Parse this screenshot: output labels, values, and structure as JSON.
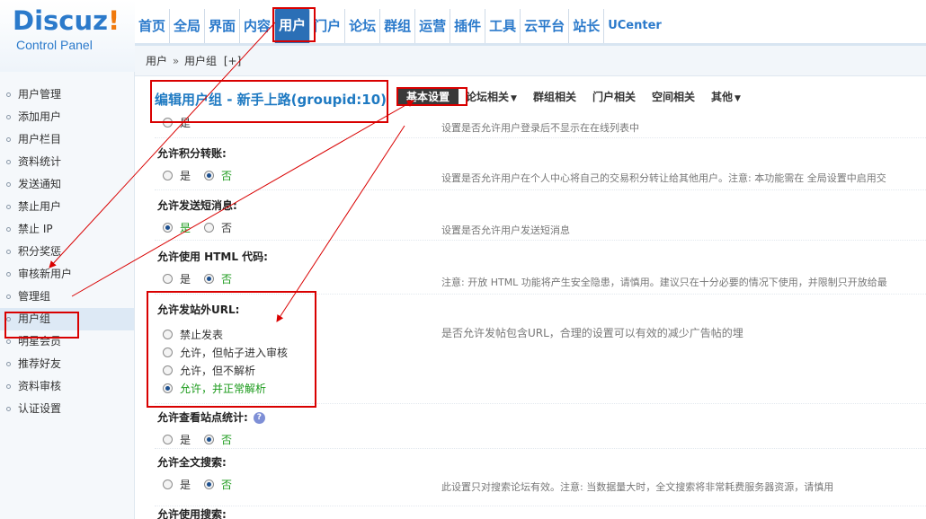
{
  "logo": {
    "brand": "Discuz",
    "bang": "!",
    "subtitle": "Control Panel"
  },
  "topnav": {
    "items": [
      "首页",
      "全局",
      "界面",
      "内容",
      "用户",
      "门户",
      "论坛",
      "群组",
      "运营",
      "插件",
      "工具",
      "云平台",
      "站长",
      "UCenter"
    ],
    "active": "用户"
  },
  "breadcrumb": {
    "first": "用户",
    "separator": "»",
    "second": "用户组",
    "add": "[+]"
  },
  "sidebar": {
    "items": [
      "用户管理",
      "添加用户",
      "用户栏目",
      "资料统计",
      "发送通知",
      "禁止用户",
      "禁止 IP",
      "积分奖惩",
      "审核新用户",
      "管理组",
      "用户组",
      "明星会员",
      "推荐好友",
      "资料审核",
      "认证设置"
    ],
    "active": "用户组"
  },
  "page_title": "编辑用户组 - 新手上路(groupid:10)",
  "tabs": {
    "basic": "基本设置",
    "forum": "论坛相关",
    "group": "群组相关",
    "portal": "门户相关",
    "space": "空间相关",
    "other": "其他"
  },
  "settings": {
    "s0": {
      "yes": "是",
      "hint": "设置是否允许用户登录后不显示在在线列表中"
    },
    "s1": {
      "label": "允许积分转账:",
      "yes": "是",
      "no": "否",
      "hint": "设置是否允许用户在个人中心将自己的交易积分转让给其他用户。注意: 本功能需在 全局设置中启用交"
    },
    "s2": {
      "label": "允许发送短消息:",
      "yes": "是",
      "no": "否",
      "hint": "设置是否允许用户发送短消息"
    },
    "s3": {
      "label": "允许使用 HTML 代码:",
      "yes": "是",
      "no": "否",
      "hint": "注意: 开放 HTML 功能将产生安全隐患，请慎用。建议只在十分必要的情况下使用，并限制只开放给最"
    },
    "s4": {
      "label": "允许发站外URL:",
      "options": [
        "禁止发表",
        "允许，但帖子进入审核",
        "允许，但不解析",
        "允许，并正常解析"
      ],
      "hint": "是否允许发帖包含URL，合理的设置可以有效的减少广告帖的埋"
    },
    "s5": {
      "label": "允许查看站点统计:",
      "help": "?",
      "yes": "是",
      "no": "否"
    },
    "s6": {
      "label": "允许全文搜索:",
      "yes": "是",
      "no": "否",
      "hint": "此设置只对搜索论坛有效。注意: 当数据量大时，全文搜索将非常耗费服务器资源，请慎用"
    },
    "s7": {
      "label": "允许使用搜索:"
    }
  },
  "annotation_color": "#d90000"
}
